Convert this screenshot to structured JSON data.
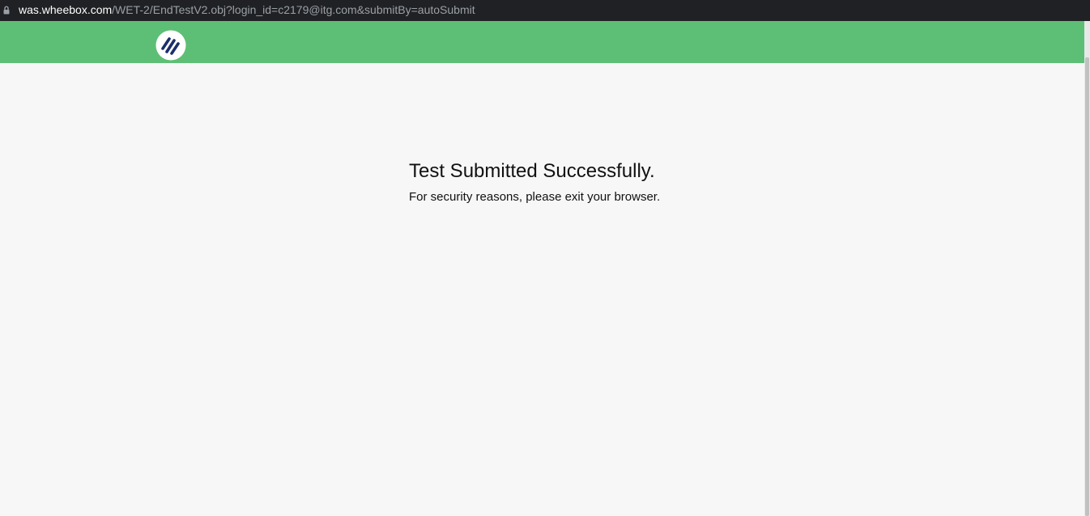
{
  "browser": {
    "url_host": "was.wheebox.com",
    "url_path": "/WET-2/EndTestV2.obj?login_id=c2179@itg.com&submitBy=autoSubmit",
    "lock_icon": "lock-icon"
  },
  "header": {
    "logo_icon": "wheebox-logo-icon",
    "color": "#5dbf75"
  },
  "main": {
    "title": "Test Submitted Successfully.",
    "message": "For security reasons, please exit your browser."
  }
}
